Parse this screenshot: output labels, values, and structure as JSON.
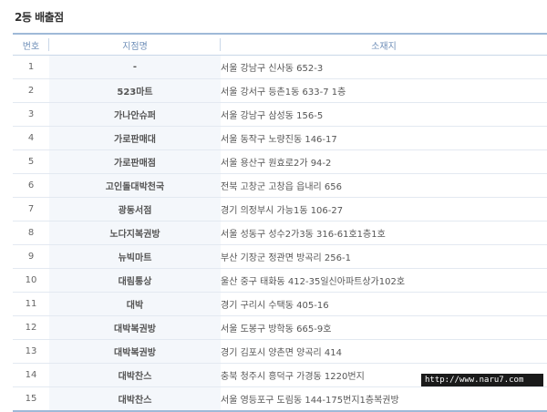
{
  "page": {
    "title": "2등 배출점"
  },
  "table": {
    "headers": {
      "no": "번호",
      "store": "지점명",
      "address": "소재지"
    },
    "rows": [
      {
        "no": "1",
        "store": "-",
        "address": "서울 강남구 신사동 652-3"
      },
      {
        "no": "2",
        "store": "523마트",
        "address": "서울 강서구 등촌1동 633-7 1층"
      },
      {
        "no": "3",
        "store": "가나안슈퍼",
        "address": "서울 강남구 삼성동 156-5"
      },
      {
        "no": "4",
        "store": "가로판매대",
        "address": "서울 동작구 노량진동 146-17"
      },
      {
        "no": "5",
        "store": "가로판매점",
        "address": "서울 용산구 원효로2가 94-2"
      },
      {
        "no": "6",
        "store": "고인돌대박천국",
        "address": "전북 고창군 고창읍 읍내리 656"
      },
      {
        "no": "7",
        "store": "광동서점",
        "address": "경기 의정부시 가능1동 106-27"
      },
      {
        "no": "8",
        "store": "노다지복권방",
        "address": "서울 성동구 성수2가3동 316-61호1층1호"
      },
      {
        "no": "9",
        "store": "뉴빅마트",
        "address": "부산 기장군 정관면 방곡리 256-1"
      },
      {
        "no": "10",
        "store": "대림통상",
        "address": "울산 중구 태화동 412-35일신아파트상가102호"
      },
      {
        "no": "11",
        "store": "대박",
        "address": "경기 구리시 수택동 405-16"
      },
      {
        "no": "12",
        "store": "대박복권방",
        "address": "서울 도봉구 방학동 665-9호"
      },
      {
        "no": "13",
        "store": "대박복권방",
        "address": "경기 김포시 양촌면 양곡리 414"
      },
      {
        "no": "14",
        "store": "대박찬스",
        "address": "충북 청주시 흥덕구 가경동 1220번지"
      },
      {
        "no": "15",
        "store": "대박찬스",
        "address": "서울 영등포구 도림동 144-175번지1층복권방"
      }
    ]
  },
  "watermark": "http://www.naru7.com"
}
